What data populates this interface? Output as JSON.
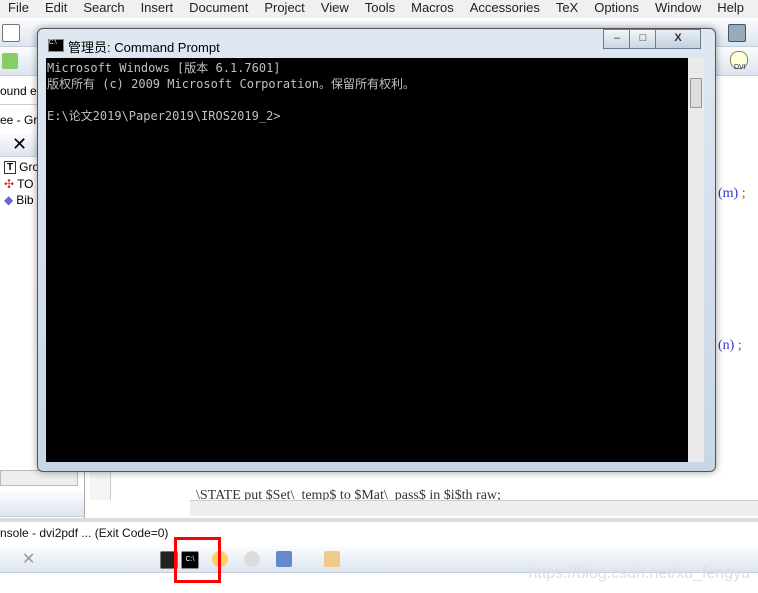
{
  "menu": [
    "File",
    "Edit",
    "Search",
    "Insert",
    "Document",
    "Project",
    "View",
    "Tools",
    "Macros",
    "Accessories",
    "TeX",
    "Options",
    "Window",
    "Help"
  ],
  "left_panel": {
    "search_fragment": "ound es",
    "tab_label": "ee - Gro",
    "tree_items": [
      {
        "label": "Gro",
        "icon": "tex-file-icon"
      },
      {
        "label": "TO",
        "icon": "toc-icon"
      },
      {
        "label": "Bib",
        "icon": "book-icon"
      }
    ]
  },
  "editor": {
    "line_m": "(m)",
    "line_n": "(n)",
    "semicolon": ";",
    "bottom_line": "\\STATE put $Set\\_temp$ to $Mat\\_pass$ in $i$th raw;"
  },
  "cmd": {
    "title": "管理员: Command Prompt",
    "minimize": "–",
    "maximize": "□",
    "close": "X",
    "lines": [
      "Microsoft Windows [版本 6.1.7601]",
      "版权所有 (c) 2009 Microsoft Corporation。保留所有权利。",
      "",
      "E:\\论文2019\\Paper2019\\IROS2019_2>"
    ]
  },
  "status": {
    "console_label": "nsole - dvi2pdf ... (Exit Code=0)"
  },
  "bottom_toolbar": {
    "cmd_icon_text": "C:\\",
    "highlight_color": "#ff0000"
  },
  "dvi_label": "DVI",
  "watermark": "https://blog.csdn.net/xu_fengyu"
}
